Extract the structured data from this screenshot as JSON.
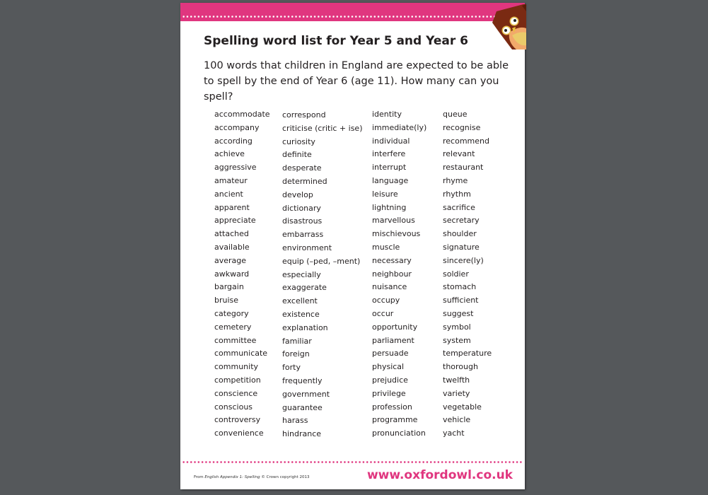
{
  "document": {
    "title": "Spelling word list for Year 5 and Year 6",
    "intro": "100 words that children in England are expected to be able to spell by the end of Year 6 (age 11). How many can you spell?",
    "accent_color": "#e0367f",
    "columns": [
      [
        "accommodate",
        "accompany",
        "according",
        "achieve",
        "aggressive",
        "amateur",
        "ancient",
        "apparent",
        "appreciate",
        "attached",
        "available",
        "average",
        "awkward",
        "bargain",
        "bruise",
        "category",
        "cemetery",
        "committee",
        "communicate",
        "community",
        "competition",
        "conscience",
        "conscious",
        "controversy",
        "convenience"
      ],
      [
        "correspond",
        "criticise (critic + ise)",
        "curiosity",
        "definite",
        "desperate",
        "determined",
        "develop",
        "dictionary",
        "disastrous",
        "embarrass",
        "environment",
        "equip (–ped, –ment)",
        "especially",
        "exaggerate",
        "excellent",
        "existence",
        "explanation",
        "familiar",
        "foreign",
        "forty",
        "frequently",
        "government",
        "guarantee",
        "harass",
        "hindrance"
      ],
      [
        "identity",
        "immediate(ly)",
        "individual",
        "interfere",
        "interrupt",
        "language",
        "leisure",
        "lightning",
        "marvellous",
        "mischievous",
        "muscle",
        "necessary",
        "neighbour",
        "nuisance",
        "occupy",
        "occur",
        "opportunity",
        "parliament",
        "persuade",
        "physical",
        "prejudice",
        "privilege",
        "profession",
        "programme",
        "pronunciation"
      ],
      [
        "queue",
        "recognise",
        "recommend",
        "relevant",
        "restaurant",
        "rhyme",
        "rhythm",
        "sacrifice",
        "secretary",
        "shoulder",
        "signature",
        "sincere(ly)",
        "soldier",
        "stomach",
        "sufficient",
        "suggest",
        "symbol",
        "system",
        "temperature",
        "thorough",
        "twelfth",
        "variety",
        "vegetable",
        "vehicle",
        "yacht"
      ]
    ],
    "footer": {
      "credit_prefix": "From ",
      "credit_source": "English Appendix 1: Spelling",
      "credit_suffix": "  © Crown copyright 2013",
      "url": "www.oxfordowl.co.uk"
    },
    "logo_icon": "owl-icon"
  }
}
